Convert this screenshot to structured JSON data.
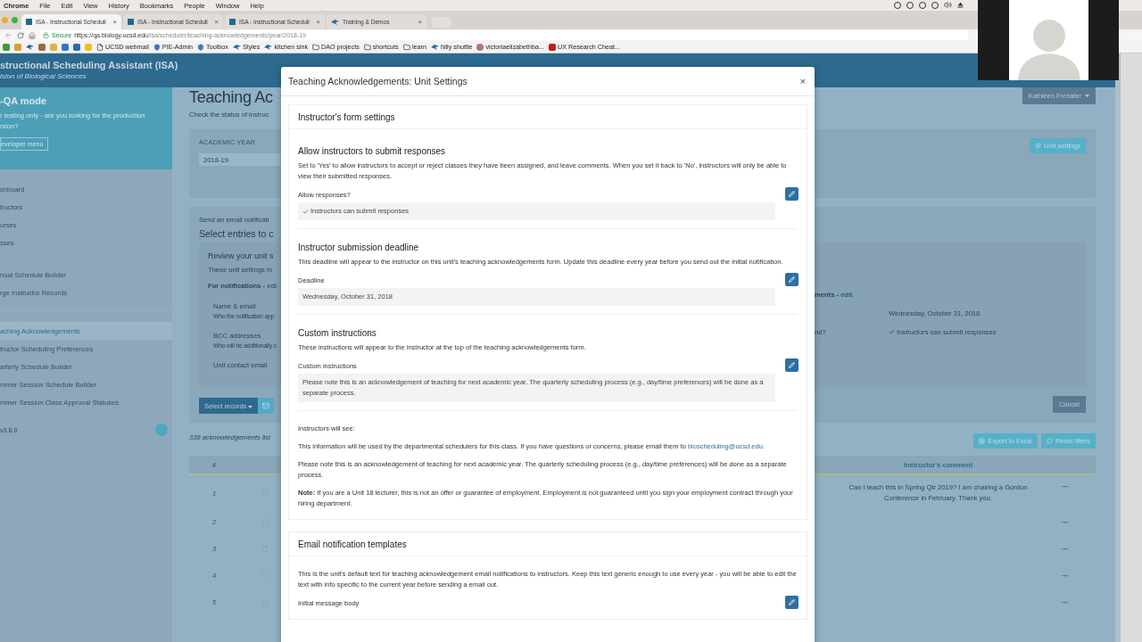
{
  "browser": {
    "menu": [
      "Chrome",
      "File",
      "Edit",
      "View",
      "History",
      "Bookmarks",
      "People",
      "Window",
      "Help"
    ],
    "tabs": [
      {
        "title": "ISA - Instructional Scheduli",
        "close": "×",
        "selected": true,
        "kind": "site"
      },
      {
        "title": "ISA - Instructional Scheduli",
        "close": "×",
        "selected": false,
        "kind": "site"
      },
      {
        "title": "ISA - Instructional Scheduli",
        "close": "×",
        "selected": false,
        "kind": "site"
      },
      {
        "title": "Training & Demos",
        "close": "×",
        "selected": false,
        "kind": "bird"
      }
    ],
    "address": {
      "secure": "Secure",
      "host": "https://qa.biology.ucsd.edu",
      "path": "/isa/scheduler/teaching-acknowledgements/year/2018-19"
    },
    "bookmarks": [
      {
        "kind": "app",
        "color": "#3c9a3c"
      },
      {
        "kind": "app",
        "color": "#d9a12a"
      },
      {
        "kind": "bird"
      },
      {
        "kind": "app",
        "color": "#9a6a3a"
      },
      {
        "kind": "app",
        "color": "#e0b040"
      },
      {
        "kind": "app",
        "color": "#2a7ad0"
      },
      {
        "kind": "app",
        "color": "#2a6ab0"
      },
      {
        "kind": "app",
        "color": "#f0c020"
      },
      {
        "kind": "page",
        "label": "UCSD webmail"
      },
      {
        "kind": "shield",
        "label": "PIE-Admin"
      },
      {
        "kind": "shield",
        "label": "Toolbox"
      },
      {
        "kind": "bird",
        "label": "Styles"
      },
      {
        "kind": "bird",
        "label": "kitchen sink"
      },
      {
        "kind": "folder",
        "label": "DAO projects"
      },
      {
        "kind": "folder",
        "label": "shortcuts"
      },
      {
        "kind": "folder",
        "label": "learn"
      },
      {
        "kind": "bird",
        "label": "hilly shuttle"
      },
      {
        "kind": "person",
        "label": "victoriaelizabethba..."
      },
      {
        "kind": "app",
        "color": "#c02020",
        "label": "UX Research Cheat..."
      }
    ]
  },
  "app": {
    "title": "structional Scheduling Assistant (ISA)",
    "subtitle": "ision of Biological Sciences",
    "qa": {
      "heading": "-QA mode",
      "lines": [
        "r testing only - are you looking for the production",
        "rsion?"
      ],
      "button": "eveloper menu"
    },
    "nav_groups": [
      [
        {
          "label": "shboard",
          "selected": false
        },
        {
          "label": "tructors",
          "selected": false
        },
        {
          "label": "urses",
          "selected": false
        },
        {
          "label": "sses",
          "selected": false
        }
      ],
      [
        {
          "label": "nual Schedule Builder",
          "selected": false
        },
        {
          "label": "rge Instructor Records",
          "selected": false
        }
      ],
      [
        {
          "label": "aching Acknowledgements",
          "selected": true
        },
        {
          "label": "tructor Scheduling Preferences",
          "selected": false
        },
        {
          "label": "arterly Schedule Builder",
          "selected": false
        },
        {
          "label": "mmer Session Schedule Builder",
          "selected": false
        },
        {
          "label": "mmer Session Class Approval Statuses",
          "selected": false
        }
      ]
    ],
    "version": "v3.6.0",
    "user_button": "Kathleen Frehafer",
    "page_heading": "Teaching Ac",
    "page_intro": "Check the status of instruc",
    "filter": {
      "label": "ACADEMIC YEAR",
      "value": "2018-19",
      "unit_settings": "Unit settings"
    },
    "notify": {
      "intro": "Send an email notificati",
      "heading": "Select entries to c",
      "review_heading": "Review your unit s",
      "review_text": "These unit settings m",
      "for_label": "For notifications - ",
      "for_link": "edi",
      "fields": [
        {
          "label": "Name & email",
          "hint": "Who the notification app"
        },
        {
          "label": "BCC addresses",
          "hint": "Who will be additionally c"
        },
        {
          "label": "Unit contact email"
        }
      ],
      "right_label": "ments - ",
      "right_link": "edit",
      "right_rows": [
        {
          "label": "",
          "value": "Wednesday, October 31, 2018",
          "kind": "text"
        },
        {
          "label": "nd?",
          "value": "Instructors can submit responses",
          "kind": "check"
        }
      ],
      "select_records": "Select records",
      "cancel": "Cancel"
    },
    "list_count": "338 acknowledgements list",
    "export": "Export to Excel",
    "reset": "Reset filters",
    "table": {
      "number_header": "#",
      "comment_header": "Instructor's comment",
      "rows": [
        {
          "number": "1",
          "checked": false,
          "comment": "Can I teach this in Spring Qtr 2019? I am chairing a Gordon Conference in February. Thank you.",
          "menu": "···"
        },
        {
          "number": "2",
          "checked": false,
          "menu": "···"
        },
        {
          "number": "3",
          "checked": false,
          "menu": "···"
        },
        {
          "number": "4",
          "checked": false,
          "menu": "···"
        },
        {
          "number": "5",
          "checked": false,
          "menu": "···"
        }
      ]
    }
  },
  "modal": {
    "title": "Teaching Acknowledgements: Unit Settings",
    "close": "×",
    "form_card": {
      "heading": "Instructor's form settings",
      "sections": [
        {
          "heading": "Allow instructors to submit responses",
          "description": "Set to 'Yes' to allow instructors to accept or reject classes they have been assigned, and leave comments. When you set it back to 'No', instructors will only be able to view their submitted responses.",
          "field_label": "Allow responses?",
          "value": "Instructors can submit responses",
          "kind": "check"
        },
        {
          "heading": "Instructor submission deadline",
          "description": "This deadline will appear to the instructor on this unit's teaching acknowledgements form. Update this deadline every year before you send out the initial notification.",
          "field_label": "Deadline",
          "value": "Wednesday, October 31, 2018",
          "kind": "text"
        },
        {
          "heading": "Custom instructions",
          "description": "These instructions will appear to the instructor at the top of the teaching acknowledgements form.",
          "field_label": "Custom instructions",
          "value": "Please note this is an acknowledgement of teaching for next academic year. The quarterly scheduling process (e.g., day/time preferences) will be done as a separate process.",
          "kind": "text"
        }
      ],
      "preview": {
        "label": "Instructors will see:",
        "contact_text": "This information will be used by the departmental schedulers for this class. If you have questions or concerns, please email them to",
        "contact_link": "bioscheduling@ucsd.edu.",
        "instructions": "Please note this is an acknowledgement of teaching for next academic year. The quarterly scheduling process (e.g., day/time preferences) will be done as a separate process.",
        "note": "**Note:** If you are a Unit 18 lecturer, this is not an offer or guarantee of employment. Employment is not guaranteed until you sign your employment contract through your hiring department."
      }
    },
    "email_card": {
      "heading": "Email notification templates",
      "description": "This is the unit's default text for teaching acknowledgement email notifications to instructors. Keep this text generic enough to use every year - you will be able to edit the text with info specific to the current year before sending a email out.",
      "field_label": "Initial message body"
    }
  }
}
